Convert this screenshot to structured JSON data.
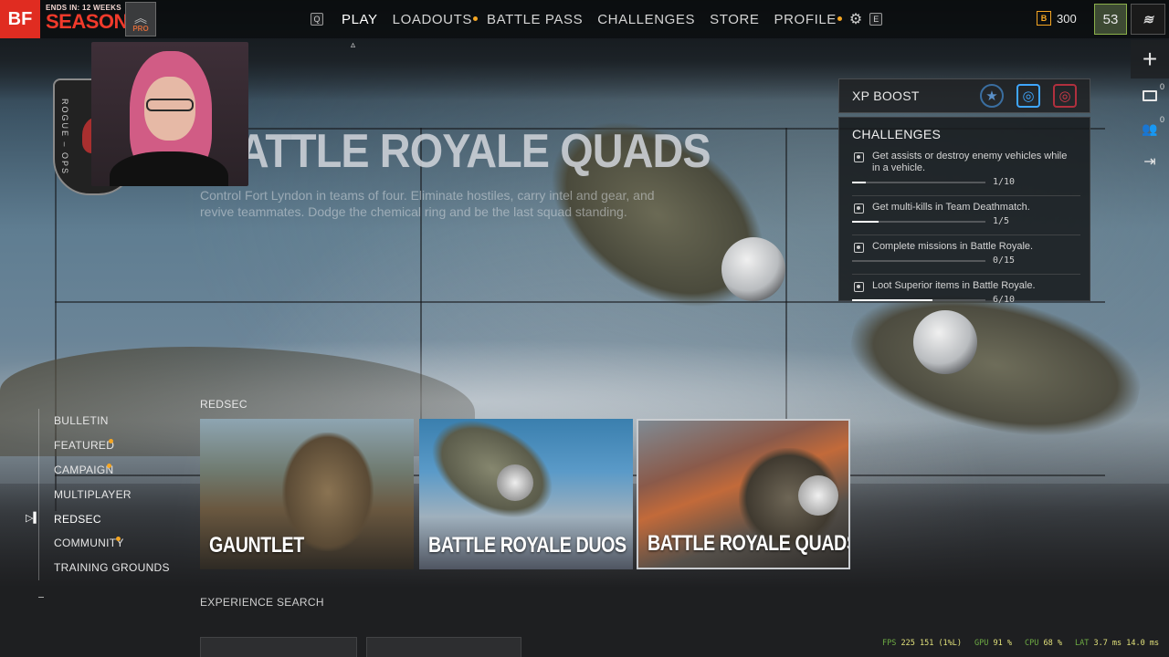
{
  "topbar": {
    "logo": "BF",
    "season_ends": "ENDS IN: 12 WEEKS",
    "season_title": "SEASON 1",
    "rank_badge": "PRO",
    "nav_left_key": "Q",
    "nav_right_key": "E",
    "nav_items": [
      {
        "label": "PLAY",
        "active": true,
        "dot": false
      },
      {
        "label": "LOADOUTS",
        "active": false,
        "dot": true
      },
      {
        "label": "BATTLE PASS",
        "active": false,
        "dot": false
      },
      {
        "label": "CHALLENGES",
        "active": false,
        "dot": false
      },
      {
        "label": "STORE",
        "active": false,
        "dot": false
      },
      {
        "label": "PROFILE",
        "active": false,
        "dot": true
      }
    ],
    "currency_icon": "B",
    "currency_amount": "300",
    "player_level": "53"
  },
  "rightbar": {
    "mail_count": "0",
    "friends_count": "0"
  },
  "hero": {
    "title": "BATTLE ROYALE QUADS",
    "description": "Control Fort Lyndon in teams of four. Eliminate hostiles, carry intel and gear, and revive teammates. Dodge the chemical ring and be the last squad standing."
  },
  "webcam_emblem": {
    "text": "ROGUE – OPS"
  },
  "xp_boost": {
    "label": "XP BOOST"
  },
  "challenges": {
    "title": "CHALLENGES",
    "items": [
      {
        "text": "Get assists or destroy enemy vehicles while in a vehicle.",
        "progress": "1/10",
        "fraction": 0.1
      },
      {
        "text": "Get multi-kills in Team Deathmatch.",
        "progress": "1/5",
        "fraction": 0.2
      },
      {
        "text": "Complete missions in Battle Royale.",
        "progress": "0/15",
        "fraction": 0.0
      },
      {
        "text": "Loot Superior items in Battle Royale.",
        "progress": "6/10",
        "fraction": 0.6
      }
    ]
  },
  "left_menu": {
    "items": [
      {
        "label": "BULLETIN",
        "active": false,
        "dot": false
      },
      {
        "label": "FEATURED",
        "active": false,
        "dot": true
      },
      {
        "label": "CAMPAIGN",
        "active": false,
        "dot": true
      },
      {
        "label": "MULTIPLAYER",
        "active": false,
        "dot": false
      },
      {
        "label": "REDSEC",
        "active": true,
        "dot": false
      },
      {
        "label": "COMMUNITY",
        "active": false,
        "dot": true
      },
      {
        "label": "TRAINING GROUNDS",
        "active": false,
        "dot": false
      }
    ]
  },
  "section": {
    "label": "REDSEC",
    "tiles": [
      {
        "name": "GAUNTLET",
        "selected": false
      },
      {
        "name": "BATTLE ROYALE DUOS",
        "selected": false
      },
      {
        "name": "BATTLE ROYALE QUADS",
        "selected": true
      }
    ]
  },
  "experience_search": {
    "label": "EXPERIENCE SEARCH"
  },
  "stats": {
    "fps_label": "FPS",
    "fps_value": "225",
    "fps_low": "151 (1%L)",
    "gpu_label": "GPU",
    "gpu_value": "91 %",
    "cpu_label": "CPU",
    "cpu_value": "68 %",
    "lat_label": "LAT",
    "lat_value": "3.7 ms",
    "lat_value2": "14.0 ms"
  },
  "colors": {
    "accent_red": "#e02c21",
    "notification_dot": "#f5a623",
    "level_border": "#8bb04a",
    "xp_blue": "#3fa6ff",
    "xp_red": "#d63a4a"
  }
}
